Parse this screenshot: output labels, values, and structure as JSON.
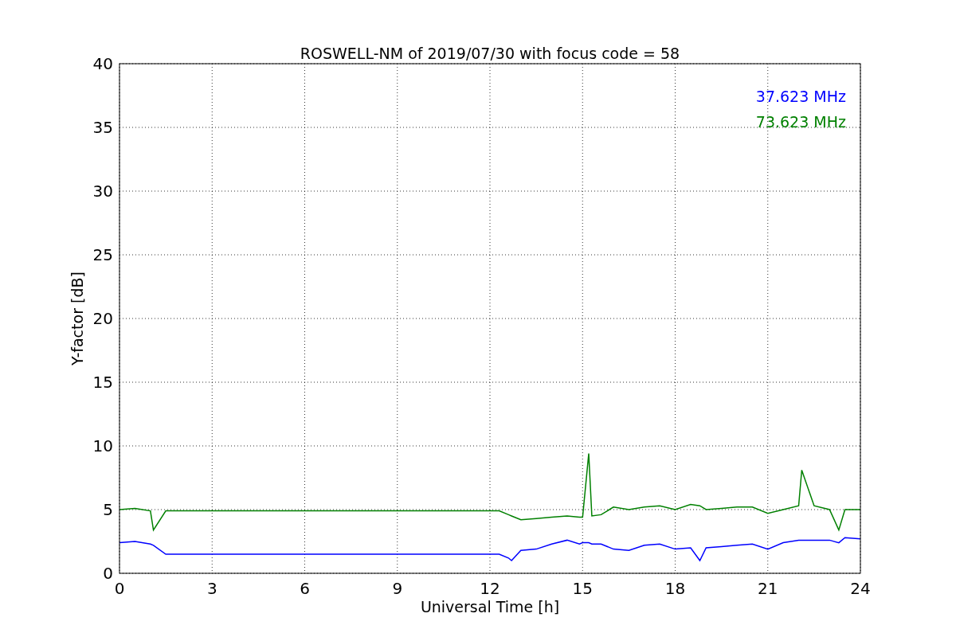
{
  "chart": {
    "chart_data": {
      "type": "line",
      "title": "ROSWELL-NM of 2019/07/30 with focus code = 58",
      "xlabel": "Universal Time [h]",
      "ylabel": "Y-factor [dB]",
      "x": [
        0,
        0.5,
        1,
        1.1,
        1.5,
        1.6,
        3,
        6,
        9,
        12.2,
        12.3,
        12.6,
        12.7,
        13,
        13.5,
        14,
        14.5,
        14.9,
        15,
        15.2,
        15.3,
        15.6,
        16,
        16.5,
        17,
        17.5,
        18,
        18.5,
        18.8,
        19,
        19.5,
        20,
        20.5,
        21,
        21.5,
        22,
        22.1,
        22.5,
        23,
        23.3,
        23.5,
        24
      ],
      "series": [
        {
          "name": "37.623 MHz",
          "color": "#0000ff",
          "values": [
            2.4,
            2.5,
            2.3,
            2.2,
            1.5,
            1.5,
            1.5,
            1.5,
            1.5,
            1.5,
            1.5,
            1.2,
            1.0,
            1.8,
            1.9,
            2.3,
            2.6,
            2.3,
            2.4,
            2.4,
            2.3,
            2.3,
            1.9,
            1.8,
            2.2,
            2.3,
            1.9,
            2.0,
            1.0,
            2.0,
            2.1,
            2.2,
            2.3,
            1.9,
            2.4,
            2.6,
            2.6,
            2.6,
            2.6,
            2.4,
            2.8,
            2.7
          ]
        },
        {
          "name": "73.623 MHz",
          "color": "#008000",
          "values": [
            5.0,
            5.1,
            4.9,
            3.4,
            4.9,
            4.9,
            4.9,
            4.9,
            4.9,
            4.9,
            4.9,
            4.6,
            4.5,
            4.2,
            4.3,
            4.4,
            4.5,
            4.4,
            4.4,
            9.4,
            4.5,
            4.6,
            5.2,
            5.0,
            5.2,
            5.3,
            5.0,
            5.4,
            5.3,
            5.0,
            5.1,
            5.2,
            5.2,
            4.7,
            5.0,
            5.3,
            8.1,
            5.3,
            5.0,
            3.4,
            5.0,
            5.0
          ]
        }
      ],
      "xlim": [
        0,
        24
      ],
      "ylim": [
        0,
        40
      ],
      "xticks": [
        0,
        3,
        6,
        9,
        12,
        15,
        18,
        21,
        24
      ],
      "yticks": [
        0,
        5,
        10,
        15,
        20,
        25,
        30,
        35,
        40
      ],
      "grid": true
    }
  }
}
